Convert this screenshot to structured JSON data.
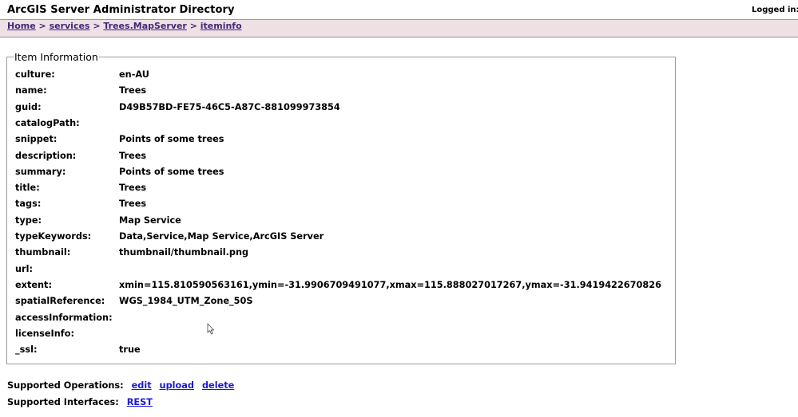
{
  "header": {
    "title": "ArcGIS Server Administrator Directory",
    "login_text": "Logged in: s"
  },
  "breadcrumb": {
    "items": [
      "Home",
      "services",
      "Trees.MapServer",
      "iteminfo"
    ],
    "separator": ">"
  },
  "item_info": {
    "legend": "Item Information",
    "rows": [
      {
        "key": "culture:",
        "value": "en-AU"
      },
      {
        "key": "name:",
        "value": "Trees"
      },
      {
        "key": "guid:",
        "value": "D49B57BD-FE75-46C5-A87C-881099973854"
      },
      {
        "key": "catalogPath:",
        "value": ""
      },
      {
        "key": "snippet:",
        "value": "Points of some trees"
      },
      {
        "key": "description:",
        "value": "Trees"
      },
      {
        "key": "summary:",
        "value": "Points of some trees"
      },
      {
        "key": "title:",
        "value": "Trees"
      },
      {
        "key": "tags:",
        "value": "Trees"
      },
      {
        "key": "type:",
        "value": "Map Service"
      },
      {
        "key": "typeKeywords:",
        "value": "Data,Service,Map Service,ArcGIS Server"
      },
      {
        "key": "thumbnail:",
        "value": "thumbnail/thumbnail.png"
      },
      {
        "key": "url:",
        "value": ""
      },
      {
        "key": "extent:",
        "value": "xmin=115.810590563161,ymin=-31.9906709491077,xmax=115.888027017267,ymax=-31.9419422670826"
      },
      {
        "key": "spatialReference:",
        "value": "WGS_1984_UTM_Zone_50S"
      },
      {
        "key": "accessInformation:",
        "value": ""
      },
      {
        "key": "licenseInfo:",
        "value": ""
      },
      {
        "key": "_ssl:",
        "value": "true"
      }
    ]
  },
  "supported_operations": {
    "label": "Supported Operations:",
    "links": [
      "edit",
      "upload",
      "delete"
    ]
  },
  "supported_interfaces": {
    "label": "Supported Interfaces:",
    "links": [
      "REST"
    ]
  },
  "colors": {
    "breadcrumb_bg": "#efe0e4",
    "breadcrumb_link": "#41287a",
    "link": "#1a1acc"
  },
  "icons": [
    "mouse-pointer-icon"
  ]
}
